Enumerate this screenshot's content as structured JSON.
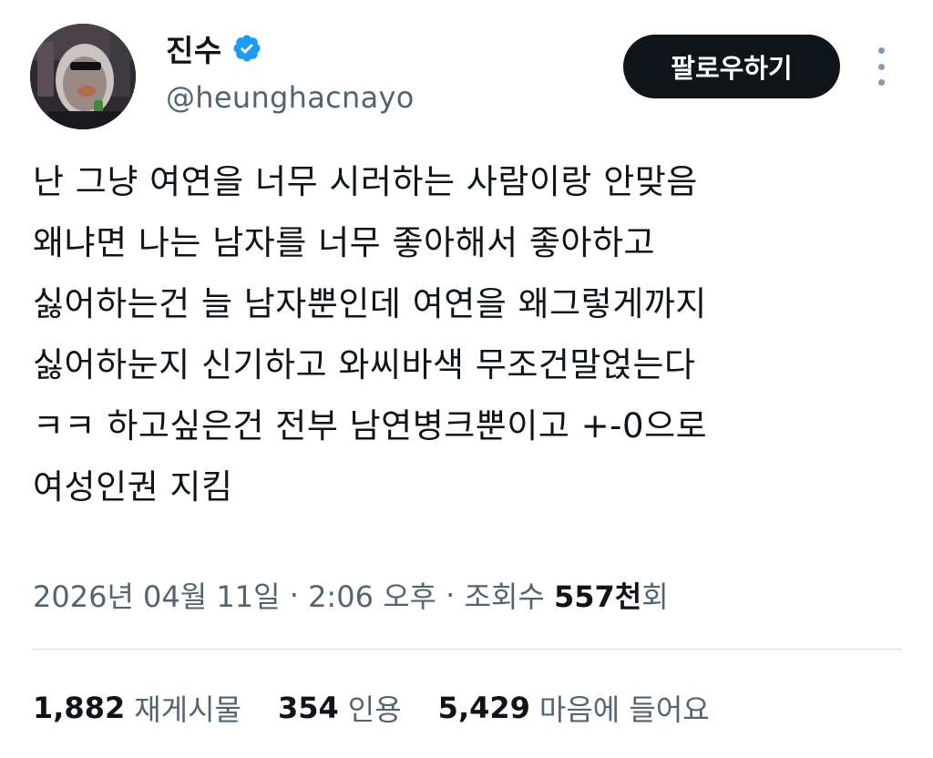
{
  "user": {
    "display_name": "진수",
    "handle": "@heunghacnayo",
    "verified_icon": "verified-badge-icon",
    "verified_color": "#1d9bf0"
  },
  "actions": {
    "follow_label": "팔로우하기",
    "more_icon": "more-vertical-icon"
  },
  "tweet": {
    "lines": [
      "난 그냥 여연을 너무 시러하는 사람이랑 안맞음",
      "왜냐면 나는 남자를 너무 좋아해서 좋아하고",
      "싫어하는건 늘 남자뿐인데 여연을 왜그렇게까지",
      "싫어하눈지 신기하고 와씨바색 무조건말얹는다",
      "ㅋㅋ 하고싶은건 전부 남연병크뿐이고 +-0으로",
      "여성인권 지킴"
    ]
  },
  "meta": {
    "date": "2026년 04월 11일",
    "separator": " · ",
    "time": "2:06 오후",
    "views_label_prefix": "조회수 ",
    "views_count": "557천",
    "views_suffix": "회"
  },
  "stats": {
    "retweets_count": "1,882",
    "retweets_label": "재게시물",
    "quotes_count": "354",
    "quotes_label": "인용",
    "likes_count": "5,429",
    "likes_label": "마음에 들어요"
  },
  "colors": {
    "text_primary": "#0f1419",
    "text_secondary": "#536471",
    "divider": "#cfd9de",
    "button_bg": "#0f1419"
  }
}
